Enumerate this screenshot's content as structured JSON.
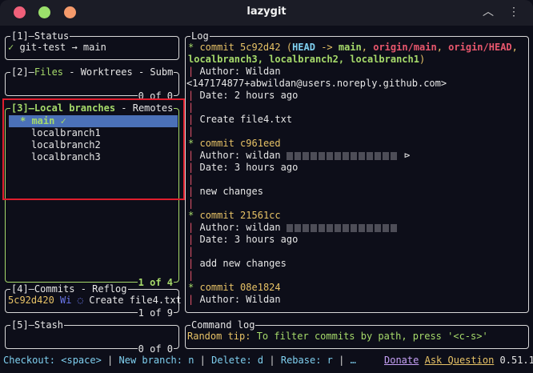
{
  "window": {
    "title": "lazygit"
  },
  "status": {
    "title": "[1]—Status",
    "check": "✓",
    "text": " git-test → main"
  },
  "files": {
    "title_num": "[2]—",
    "title_active": "Files",
    "title_rest": " - Worktrees - Subm",
    "footer": "0 of 0"
  },
  "branches": {
    "title_num": "[3]—",
    "title_active": "Local branches",
    "title_rest": " - Remotes",
    "footer": "1 of 4",
    "items": [
      {
        "star": "* ",
        "name": "main",
        "mark": " ✓"
      },
      {
        "name": "localbranch1"
      },
      {
        "name": "localbranch2"
      },
      {
        "name": "localbranch3"
      }
    ]
  },
  "commits": {
    "title": "[4]—Commits - Reflog",
    "hash": "5c92d420",
    "author": "Wi",
    "icon": "◌",
    "message": "Create file4.txt",
    "footer": "1 of 9"
  },
  "stash": {
    "title": "[5]—Stash",
    "footer": "0 of 0"
  },
  "log": {
    "title": "Log",
    "commit1": {
      "star": "* ",
      "label": "commit 5c92d42 ",
      "paren_open": "(",
      "head": "HEAD",
      "arrow": " -> ",
      "main": "main",
      "sep1": ", ",
      "origin_main": "origin/main",
      "sep2": ", ",
      "origin_head": "origin/HEAD",
      "sep3": ",",
      "branches": "localbranch3, localbranch2, localbranch1",
      "paren_close": ")",
      "author": "Author: Wildan",
      "email": "<147174877+abwildan@users.noreply.github.com>",
      "date": "Date:   2 hours ago",
      "message": "Create file4.txt"
    },
    "commit2": {
      "label": "commit c961eed",
      "author": "Author: wildan",
      "date": "Date:   3 hours ago",
      "message": "new changes"
    },
    "commit3": {
      "label": "commit 21561cc",
      "author": "Author: wildan",
      "date": "Date:   3 hours ago",
      "message": "add new changes"
    },
    "commit4": {
      "label": "commit 08e1824",
      "author": "Author: Wildan"
    },
    "bar": "|",
    "star": "*"
  },
  "command_log": {
    "title": "Command log",
    "tip_label": "Random tip:",
    "tip_text": " To filter commits by path, press '<c-s>'"
  },
  "bottom": {
    "checkout": "Checkout: <space>",
    "sep": " | ",
    "new_branch": "New branch: n",
    "delete": "Delete: d",
    "rebase": "Rebase: r",
    "ellipsis": "…",
    "donate": "Donate",
    "ask": "Ask Question",
    "version": "0.51.1"
  },
  "colors": {
    "active_border": "#a6da6a",
    "selection": "#4b71b8",
    "highlight_box": "#e01e2d"
  }
}
